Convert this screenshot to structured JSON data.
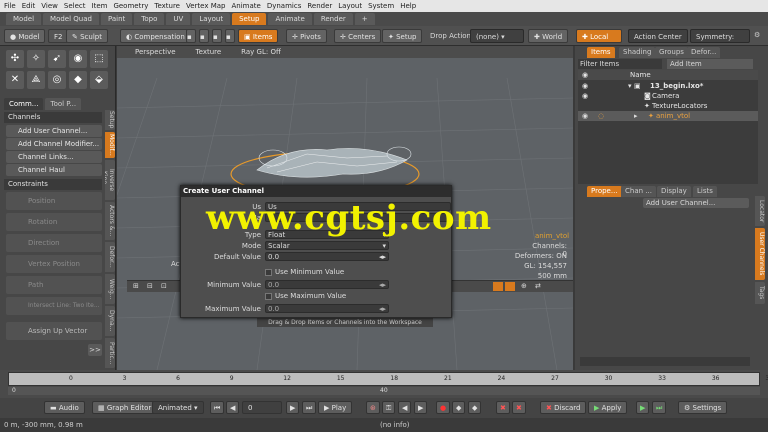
{
  "menubar": [
    "File",
    "Edit",
    "View",
    "Select",
    "Item",
    "Geometry",
    "Texture",
    "Vertex Map",
    "Animate",
    "Dynamics",
    "Render",
    "Layout",
    "System",
    "Help"
  ],
  "layout_tabs": [
    {
      "label": "Model",
      "active": false
    },
    {
      "label": "Model Quad",
      "active": false
    },
    {
      "label": "Paint",
      "active": false
    },
    {
      "label": "Topo",
      "active": false
    },
    {
      "label": "UV",
      "active": false
    },
    {
      "label": "Layout",
      "active": false
    },
    {
      "label": "Setup",
      "active": true
    },
    {
      "label": "Animate",
      "active": false
    },
    {
      "label": "Render",
      "active": false
    },
    {
      "label": "+",
      "active": false
    }
  ],
  "toolbar": {
    "model": "Model",
    "f2": "F2",
    "sculpt": "Sculpt",
    "compensation": "Compensation",
    "items": "Items",
    "pivots": "Pivots",
    "centers": "Centers",
    "setup": "Setup",
    "drop_action": "Drop Action",
    "drop_value": "(none)",
    "world": "World",
    "local": "Local",
    "action_center": "Action Center",
    "symmetry": "Symmetry: Off"
  },
  "left_panel": {
    "tabs": [
      "Comm...",
      "Tool P..."
    ],
    "channels_header": "Channels",
    "channel_items": [
      "Add User Channel...",
      "Add Channel Modifier...",
      "Channel Links...",
      "Channel Haul"
    ],
    "constraints_header": "Constraints",
    "constraint_items": [
      "Position",
      "Rotation",
      "Direction",
      "Vertex Position",
      "Path",
      "Intersect Line: Two Ite...",
      "Assign Up Vector"
    ],
    "side_tabs": [
      "Setup",
      "Modif...",
      "Inverse Kine...",
      "Actors &...",
      "Defor...",
      "Weig...",
      "Dyna...",
      "Partic..."
    ],
    "more": ">>"
  },
  "viewport": {
    "header": [
      "Perspective",
      "Texture",
      "Ray GL: Off"
    ],
    "info": {
      "item": "anim_vtol",
      "channels": "Channels: 0",
      "deformers": "Deformers: ON",
      "gl": "GL: 154,557",
      "size": "500 mm"
    },
    "drag_hint": "Drag & Drop Items or Channels into the Workspace",
    "acti": "Acti"
  },
  "right_panel": {
    "tabs": [
      "Items",
      "Shading",
      "Groups",
      "Defor..."
    ],
    "filter": "Filter Items",
    "add_item": "Add Item",
    "name_col": "Name",
    "tree": [
      {
        "label": "13_begin.lxo*",
        "indent": 14
      },
      {
        "label": "Camera",
        "indent": 20
      },
      {
        "label": "TextureLocators",
        "indent": 20
      },
      {
        "label": "anim_vtol",
        "indent": 32
      }
    ],
    "prop_tabs": [
      "Prope...",
      "Chan ...",
      "Display",
      "Lists"
    ],
    "add_user_channel": "Add User Channel...",
    "side_tabs": [
      "Locator",
      "User Channels",
      "Tags"
    ]
  },
  "dialog": {
    "title": "Create User Channel",
    "username_label": "Us",
    "name_label": "Na",
    "username_value": "Us",
    "type_label": "Type",
    "type_value": "Float",
    "mode_label": "Mode",
    "mode_value": "Scalar",
    "default_label": "Default Value",
    "default_value": "0.0",
    "use_min": "Use Minimum Value",
    "min_label": "Minimum Value",
    "min_value": "0.0",
    "use_max": "Use Maximum Value",
    "max_label": "Maximum Value",
    "max_value": "0.0"
  },
  "watermark": "www.cgtsj.com",
  "timeline": {
    "ticks": [
      "0",
      "3",
      "6",
      "9",
      "12",
      "15",
      "18",
      "21",
      "24",
      "27",
      "30",
      "33",
      "36",
      "39"
    ],
    "sub_ticks": [
      "0",
      "40"
    ]
  },
  "bottombar": {
    "audio": "Audio",
    "graph_editor": "Graph Editor",
    "animated": "Animated",
    "frame": "0",
    "play": "Play",
    "discard": "Discard",
    "apply": "Apply",
    "settings": "Settings"
  },
  "statusbar": {
    "coords": "0 m, -300 mm, 0.98 m",
    "info": "(no info)"
  }
}
